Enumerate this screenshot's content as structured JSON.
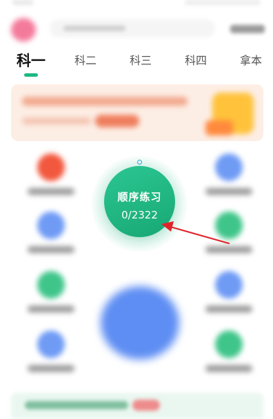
{
  "tabs": [
    {
      "label": "科一",
      "active": true
    },
    {
      "label": "科二",
      "active": false
    },
    {
      "label": "科三",
      "active": false
    },
    {
      "label": "科四",
      "active": false
    },
    {
      "label": "拿本",
      "active": false
    }
  ],
  "practice": {
    "title": "顺序练习",
    "progress": "0/2322"
  },
  "colors": {
    "accent_green": "#1fb982",
    "arrow_red": "#e0242c",
    "banner_bg": "#fdeee5",
    "blue_tile": "#5e8ef3"
  },
  "icons": {
    "avatar": "avatar-icon",
    "orbit_marker": "orbit-dot-icon"
  }
}
